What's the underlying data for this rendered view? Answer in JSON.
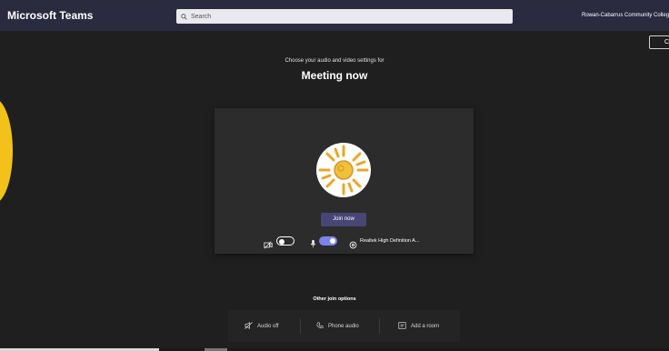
{
  "app": {
    "title": "Microsoft Teams",
    "organization": "Rowan-Cabarrus Community College"
  },
  "search": {
    "placeholder": "Search",
    "icon": "search-icon"
  },
  "header_button": {
    "label": "Cl"
  },
  "prejoin": {
    "subtitle": "Choose your audio and video settings for",
    "meeting_title": "Meeting now",
    "join_label": "Join now",
    "camera": {
      "state": "off",
      "icon": "camera-off-icon"
    },
    "microphone": {
      "state": "on",
      "icon": "microphone-icon"
    },
    "device": {
      "icon": "settings-icon",
      "label": "Realtek High Definition A..."
    }
  },
  "other_join": {
    "title": "Other join options",
    "options": [
      {
        "label": "Audio off",
        "icon": "speaker-off-icon"
      },
      {
        "label": "Phone audio",
        "icon": "phone-icon"
      },
      {
        "label": "Add a room",
        "icon": "room-icon"
      }
    ]
  },
  "colors": {
    "topbar": "#2b2b40",
    "background": "#1f1f1f",
    "panel": "#2d2c2c",
    "accent": "#464775",
    "toggle_on": "#7b83eb",
    "avatar_sun": "#e8a628"
  }
}
